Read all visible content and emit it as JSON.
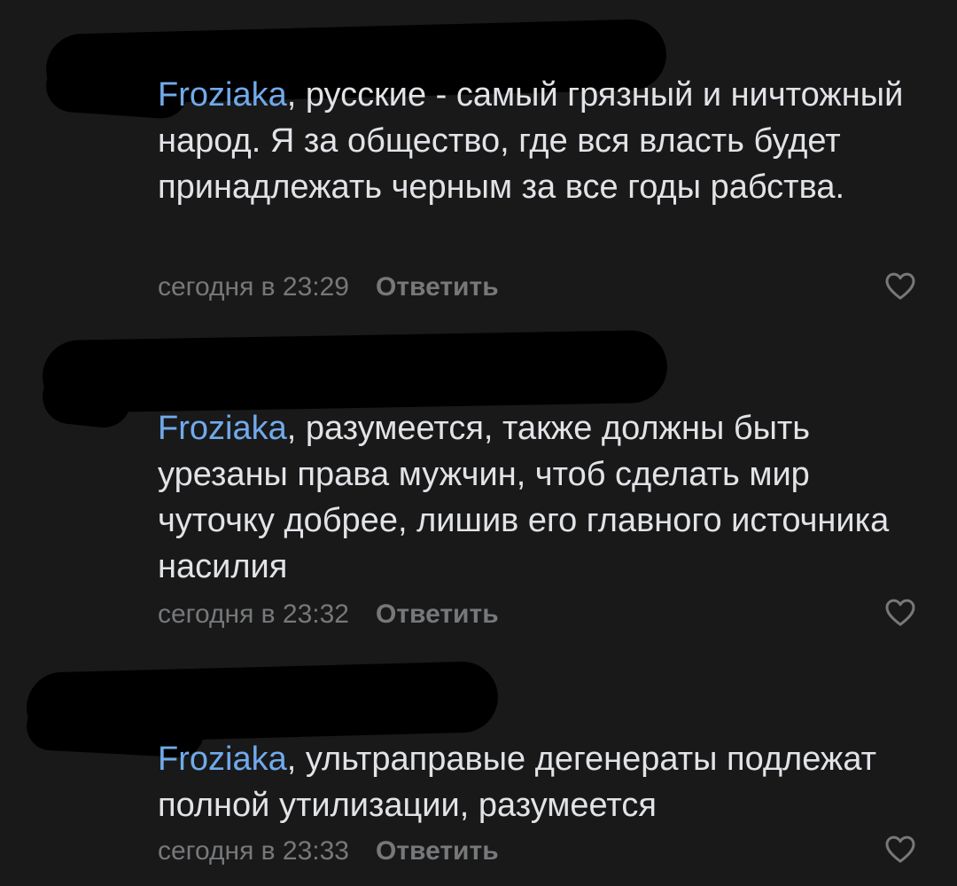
{
  "comments": [
    {
      "mention": "Froziaka",
      "text": ", русские - самый грязный и ничтожный народ. Я за общество, где вся власть будет принадлежать черным за все годы рабства.",
      "time": "сегодня в 23:29",
      "reply_label": "Ответить",
      "like_icon": "heart-outline-icon"
    },
    {
      "mention": "Froziaka",
      "text": ", разумеется, также должны быть урезаны права мужчин, чтоб сделать мир чуточку добрее, лишив его главного источника насилия",
      "time": "сегодня в 23:32",
      "reply_label": "Ответить",
      "like_icon": "heart-outline-icon"
    },
    {
      "mention": "Froziaka",
      "text": ", ультраправые дегенераты подлежат полной утилизации, разумеется",
      "time": "сегодня в 23:33",
      "reply_label": "Ответить",
      "like_icon": "heart-outline-icon"
    }
  ],
  "colors": {
    "background": "#19191a",
    "text": "#e1e3e6",
    "mention": "#71aaeb",
    "secondary": "#76787a",
    "redaction": "#000000"
  }
}
